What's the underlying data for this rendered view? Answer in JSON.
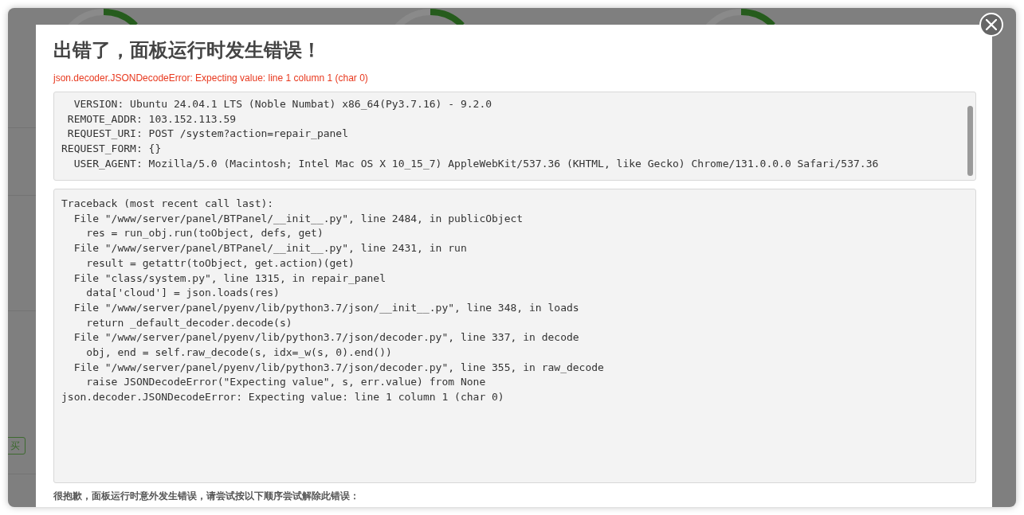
{
  "background": {
    "buy_button": "买"
  },
  "dialog": {
    "title": "出错了，面板运行时发生错误！",
    "error": "json.decoder.JSONDecodeError: Expecting value: line 1 column 1 (char 0)",
    "request_info": [
      "  VERSION: Ubuntu 24.04.1 LTS (Noble Numbat) x86_64(Py3.7.16) - 9.2.0",
      " REMOTE_ADDR: 103.152.113.59",
      " REQUEST_URI: POST /system?action=repair_panel",
      "REQUEST_FORM: {}",
      "  USER_AGENT: Mozilla/5.0 (Macintosh; Intel Mac OS X 10_15_7) AppleWebKit/537.36 (KHTML, like Gecko) Chrome/131.0.0.0 Safari/537.36"
    ],
    "traceback": [
      "Traceback (most recent call last):",
      "  File \"/www/server/panel/BTPanel/__init__.py\", line 2484, in publicObject",
      "    res = run_obj.run(toObject, defs, get)",
      "  File \"/www/server/panel/BTPanel/__init__.py\", line 2431, in run",
      "    result = getattr(toObject, get.action)(get)",
      "  File \"class/system.py\", line 1315, in repair_panel",
      "    data['cloud'] = json.loads(res)",
      "  File \"/www/server/panel/pyenv/lib/python3.7/json/__init__.py\", line 348, in loads",
      "    return _default_decoder.decode(s)",
      "  File \"/www/server/panel/pyenv/lib/python3.7/json/decoder.py\", line 337, in decode",
      "    obj, end = self.raw_decode(s, idx=_w(s, 0).end())",
      "  File \"/www/server/panel/pyenv/lib/python3.7/json/decoder.py\", line 355, in raw_decode",
      "    raise JSONDecodeError(\"Expecting value\", s, err.value) from None",
      "json.decoder.JSONDecodeError: Expecting value: line 1 column 1 (char 0)"
    ],
    "hint": "很抱歉，面板运行时意外发生错误，请尝试按以下顺序尝试解除此错误："
  }
}
